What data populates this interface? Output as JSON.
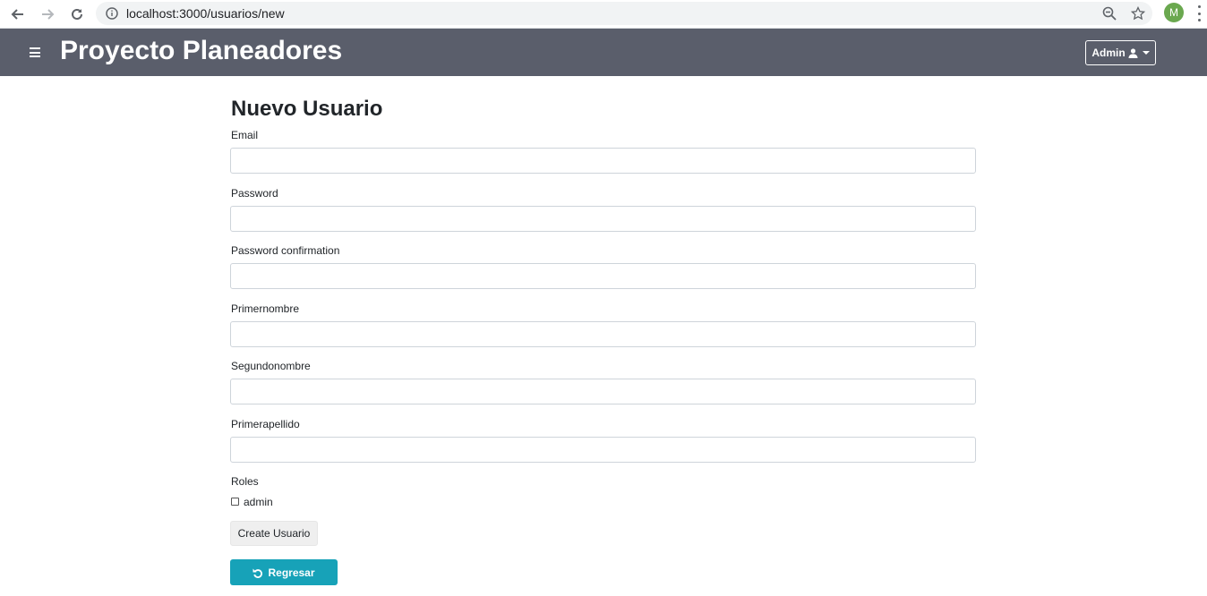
{
  "browser": {
    "url": "localhost:3000/usuarios/new",
    "avatar_letter": "M"
  },
  "navbar": {
    "brand": "Proyecto Planeadores",
    "user_menu_label": "Admin"
  },
  "form": {
    "title": "Nuevo Usuario",
    "fields": [
      {
        "label": "Email",
        "value": ""
      },
      {
        "label": "Password",
        "value": ""
      },
      {
        "label": "Password confirmation",
        "value": ""
      },
      {
        "label": "Primernombre",
        "value": ""
      },
      {
        "label": "Segundonombre",
        "value": ""
      },
      {
        "label": "Primerapellido",
        "value": ""
      }
    ],
    "roles_label": "Roles",
    "role_option": {
      "label": "admin",
      "checked": false
    },
    "submit_label": "Create Usuario",
    "back_label": "Regresar"
  },
  "colors": {
    "navbar_bg": "#5a5e6b",
    "back_button": "#17a2b8",
    "avatar": "#6aa84f"
  }
}
